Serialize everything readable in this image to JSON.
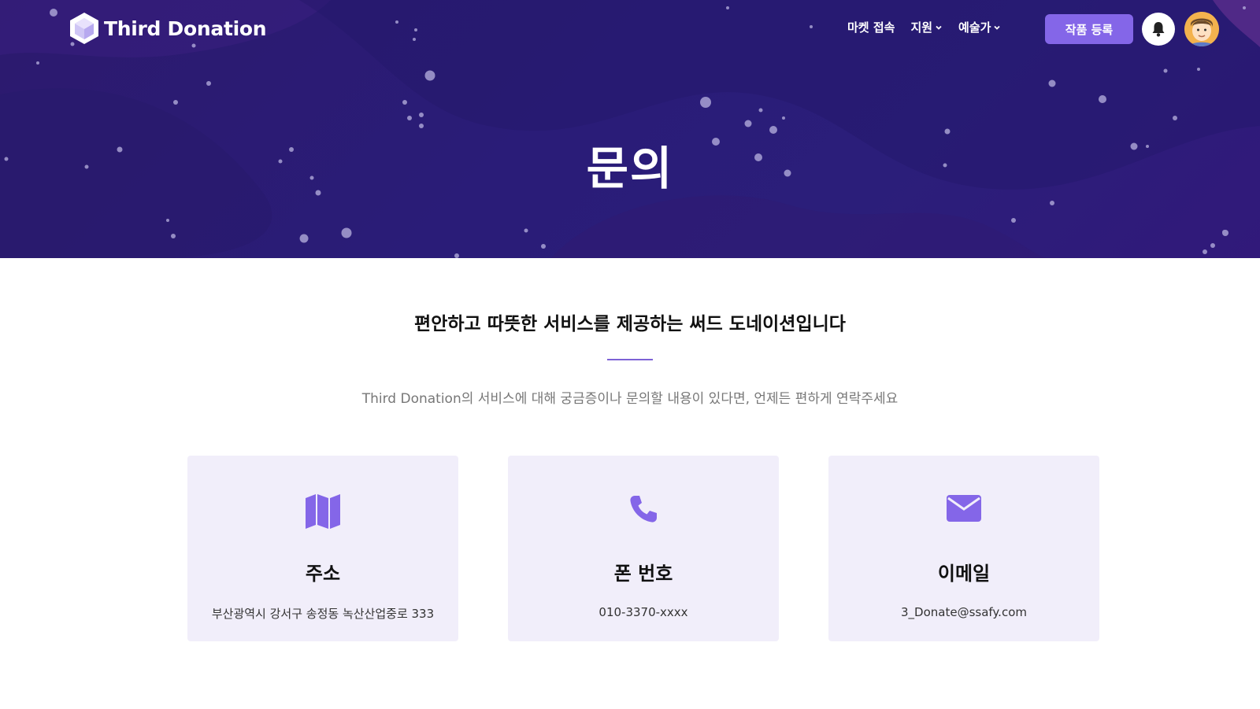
{
  "brand": {
    "name": "Third Donation",
    "logo_icon": "hexagon-cube-icon"
  },
  "nav": {
    "items": [
      {
        "label": "마켓 접속",
        "has_dropdown": false
      },
      {
        "label": "지원",
        "has_dropdown": true
      },
      {
        "label": "예술가",
        "has_dropdown": true
      }
    ],
    "register_button": "작품 등록",
    "notification_icon": "bell-icon",
    "avatar_icon": "user-avatar"
  },
  "hero": {
    "title": "문의"
  },
  "intro": {
    "headline": "편안하고 따뜻한 서비스를 제공하는 써드 도네이션입니다",
    "subline": "Third Donation의 서비스에 대해 궁금증이나 문의할 내용이 있다면, 언제든 편하게 연락주세요"
  },
  "cards": [
    {
      "icon": "map-icon",
      "title": "주소",
      "value": "부산광역시 강서구 송정동 녹산산업중로 333"
    },
    {
      "icon": "phone-icon",
      "title": "폰 번호",
      "value": "010-3370-xxxx"
    },
    {
      "icon": "mail-icon",
      "title": "이메일",
      "value": "3_Donate@ssafy.com"
    }
  ],
  "colors": {
    "hero_bg": "#2b1b78",
    "accent": "#8466e8",
    "card_bg": "#f1eefa"
  }
}
